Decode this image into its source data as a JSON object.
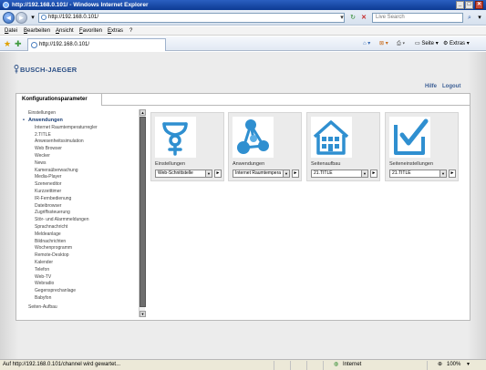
{
  "window": {
    "title": "http://192.168.0.101/ - Windows Internet Explorer",
    "min": "_",
    "max": "□",
    "close": "✕"
  },
  "address": {
    "url": "http://192.168.0.101/",
    "search_placeholder": "Live Search"
  },
  "menu": [
    "Datei",
    "Bearbeiten",
    "Ansicht",
    "Favoriten",
    "Extras",
    "?"
  ],
  "tab": {
    "label": "http://192.168.0.101/"
  },
  "commands": {
    "page": "Seite",
    "tools": "Extras"
  },
  "page": {
    "brand": "BUSCH-JAEGER",
    "help": "Hilfe",
    "logout": "Logout",
    "panel_title": "Konfigurationsparameter"
  },
  "tree": [
    {
      "label": "Einstellungen",
      "level": 0
    },
    {
      "label": "Anwendungen",
      "level": 0,
      "active": true
    },
    {
      "label": "Internet Raumtemperaturregler",
      "level": 1
    },
    {
      "label": "2.TITLE",
      "level": 1
    },
    {
      "label": "Anwesenheitssimulation",
      "level": 1
    },
    {
      "label": "Web Browser",
      "level": 1
    },
    {
      "label": "Wecker",
      "level": 1
    },
    {
      "label": "News",
      "level": 1
    },
    {
      "label": "Kameraüberwachung",
      "level": 1
    },
    {
      "label": "Media-Player",
      "level": 1
    },
    {
      "label": "Szeneneditor",
      "level": 1
    },
    {
      "label": "Kurzzeittimer",
      "level": 1
    },
    {
      "label": "IR-Fernbedienung",
      "level": 1
    },
    {
      "label": "Dateibrowser",
      "level": 1
    },
    {
      "label": "Zugriffssteuerung",
      "level": 1
    },
    {
      "label": "Stör- und Alarmmeldungen",
      "level": 1
    },
    {
      "label": "Sprachnachricht",
      "level": 1
    },
    {
      "label": "Meldeanlage",
      "level": 1
    },
    {
      "label": "Bildnachrichten",
      "level": 1
    },
    {
      "label": "Wochenprogramm",
      "level": 1
    },
    {
      "label": "Remote-Desktop",
      "level": 1
    },
    {
      "label": "Kalender",
      "level": 1
    },
    {
      "label": "Telefon",
      "level": 1
    },
    {
      "label": "Web-TV",
      "level": 1
    },
    {
      "label": "Webradio",
      "level": 1
    },
    {
      "label": "Gegensprechanlage",
      "level": 1
    },
    {
      "label": "Babyfon",
      "level": 1
    },
    {
      "label": "Seiten-Aufbau",
      "level": 0
    }
  ],
  "tiles": [
    {
      "title": "Einstellungen",
      "select": "Web-Schnittstelle",
      "icon": "settings-wrench-icon"
    },
    {
      "title": "Anwendungen",
      "select": "Internet Raumtempera",
      "icon": "molecule-icon"
    },
    {
      "title": "Seitenaufbau",
      "select": "21.TITLE",
      "icon": "house-icon"
    },
    {
      "title": "Seiteneinstellungen",
      "select": "21.TITLE",
      "icon": "checkbox-icon"
    }
  ],
  "status": {
    "text": "Auf http://192.168.0.101/channel wird gewartet...",
    "zone": "Internet",
    "zoom": "100%"
  },
  "colors": {
    "titlebar": "#0d3b94",
    "brand": "#2b4f86",
    "icon_blue": "#2f8fd0"
  }
}
